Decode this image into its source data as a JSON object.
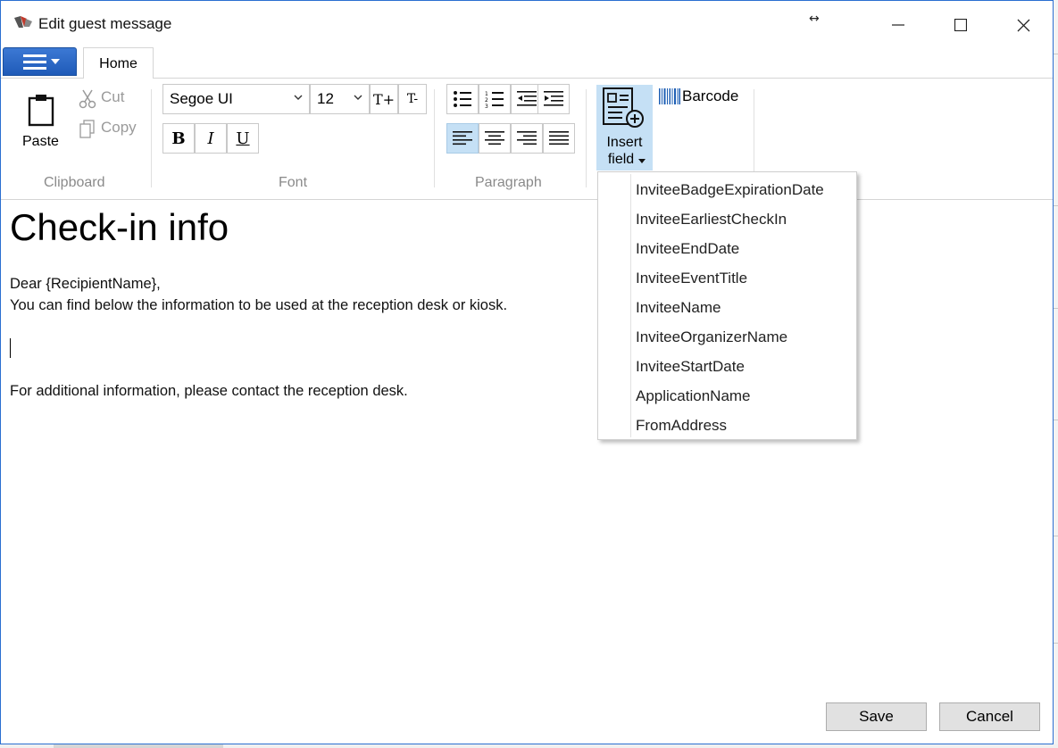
{
  "window": {
    "title": "Edit guest message"
  },
  "ribbon": {
    "tab_home": "Home",
    "clipboard": {
      "paste": "Paste",
      "cut": "Cut",
      "copy": "Copy",
      "group_label": "Clipboard"
    },
    "font": {
      "family": "Segoe UI",
      "size": "12",
      "grow_label": "T+",
      "shrink_label": "T-",
      "bold": "B",
      "italic": "I",
      "underline": "U",
      "group_label": "Font"
    },
    "paragraph": {
      "group_label": "Paragraph",
      "active_alignment": "left"
    },
    "insert": {
      "insert_field_line1": "Insert",
      "insert_field_line2": "field",
      "barcode": "Barcode"
    }
  },
  "editor": {
    "heading": "Check-in info",
    "lines": [
      "Dear {RecipientName},",
      "You can find below the information to be used at the reception desk or kiosk.",
      "For additional information, please contact the reception desk."
    ]
  },
  "insert_field_menu": {
    "items": [
      "InviteeBadgeExpirationDate",
      "InviteeEarliestCheckIn",
      "InviteeEndDate",
      "InviteeEventTitle",
      "InviteeName",
      "InviteeOrganizerName",
      "InviteeStartDate",
      "ApplicationName",
      "FromAddress"
    ]
  },
  "footer": {
    "save": "Save",
    "cancel": "Cancel"
  },
  "colors": {
    "accent": "#2b6fd1",
    "ribbon_highlight": "#c5e0f5",
    "button_face": "#e1e1e1"
  }
}
